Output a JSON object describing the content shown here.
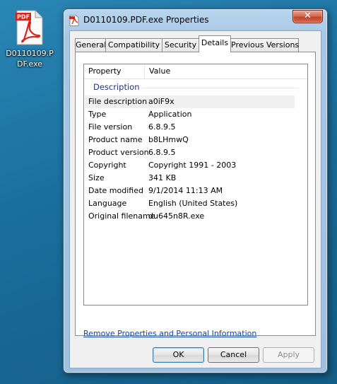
{
  "desktop": {
    "icon_label": "D0110109.PDF.exe",
    "icon_badge": "PDF",
    "icon_name": "pdf-file-icon"
  },
  "window": {
    "title": "D0110109.PDF.exe Properties",
    "close_glyph": "✕"
  },
  "tabs": [
    {
      "label": "General",
      "active": false
    },
    {
      "label": "Compatibility",
      "active": false
    },
    {
      "label": "Security",
      "active": false
    },
    {
      "label": "Details",
      "active": true
    },
    {
      "label": "Previous Versions",
      "active": false
    }
  ],
  "details": {
    "columns": {
      "property": "Property",
      "value": "Value"
    },
    "group": "Description",
    "rows": [
      {
        "property": "File description",
        "value": "a0iF9x"
      },
      {
        "property": "Type",
        "value": "Application"
      },
      {
        "property": "File version",
        "value": "6.8.9.5"
      },
      {
        "property": "Product name",
        "value": "b8LHmwQ"
      },
      {
        "property": "Product version",
        "value": "6.8.9.5"
      },
      {
        "property": "Copyright",
        "value": "Copyright 1991 - 2003"
      },
      {
        "property": "Size",
        "value": "341 KB"
      },
      {
        "property": "Date modified",
        "value": "9/1/2014 11:13 AM"
      },
      {
        "property": "Language",
        "value": "English (United States)"
      },
      {
        "property": "Original filename",
        "value": "du645n8R.exe"
      }
    ]
  },
  "link": "Remove Properties and Personal Information",
  "buttons": {
    "ok": "OK",
    "cancel": "Cancel",
    "apply": "Apply"
  },
  "colors": {
    "desktop": "#1a6e9c",
    "link": "#0645ad",
    "group_header": "#1e3287",
    "pdf_red": "#d8231b"
  }
}
